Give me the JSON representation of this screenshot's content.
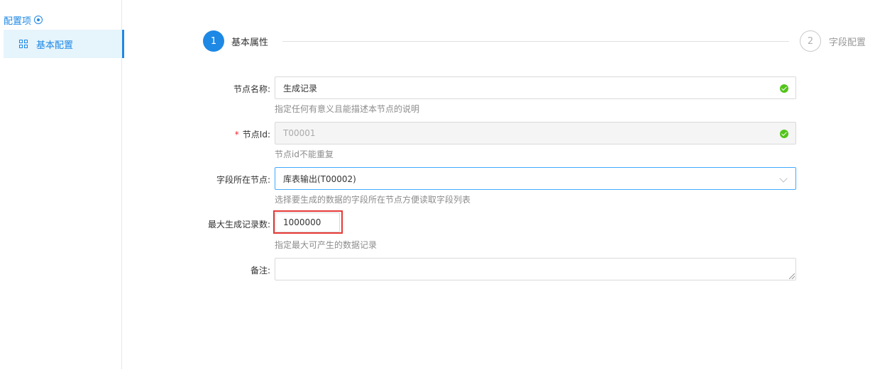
{
  "sidebar": {
    "title": "配置项",
    "items": [
      {
        "label": "基本配置",
        "icon": "grid-icon"
      }
    ]
  },
  "steps": [
    {
      "number": "1",
      "label": "基本属性",
      "active": true
    },
    {
      "number": "2",
      "label": "字段配置",
      "active": false
    }
  ],
  "form": {
    "node_name": {
      "label": "节点名称:",
      "value": "生成记录",
      "help": "指定任何有意义且能描述本节点的说明"
    },
    "node_id": {
      "required_mark": "*",
      "label": "节点Id:",
      "value": "T00001",
      "help": "节点id不能重复"
    },
    "field_node": {
      "label": "字段所在节点:",
      "value": "库表输出(T00002)",
      "help": "选择要生成的数据的字段所在节点方便读取字段列表"
    },
    "max_records": {
      "label": "最大生成记录数:",
      "value": "1000000",
      "help": "指定最大可产生的数据记录"
    },
    "remark": {
      "label": "备注:",
      "value": ""
    }
  },
  "colors": {
    "accent": "#1e88e5",
    "success": "#52c41a",
    "highlight": "#e53935",
    "required": "#f5222d"
  }
}
